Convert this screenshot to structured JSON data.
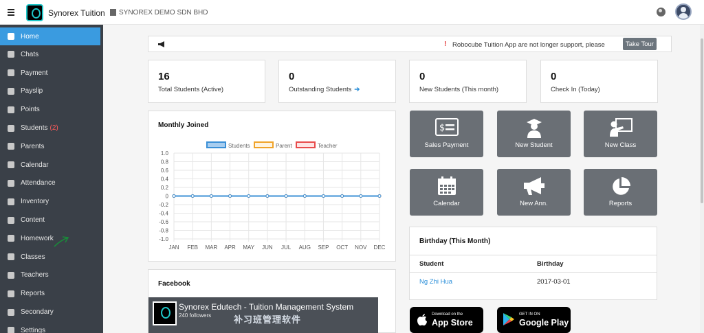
{
  "header": {
    "app_name": "Synorex Tuition",
    "org_name": "SYNOREX DEMO SDN BHD"
  },
  "sidebar": {
    "items": [
      {
        "label": "Home",
        "icon": "home-icon",
        "active": true
      },
      {
        "label": "Chats",
        "icon": "chat-icon"
      },
      {
        "label": "Payment",
        "icon": "document-icon"
      },
      {
        "label": "Payslip",
        "icon": "document-icon"
      },
      {
        "label": "Points",
        "icon": "star-icon"
      },
      {
        "label": "Students",
        "icon": "users-icon",
        "badge": "(2)"
      },
      {
        "label": "Parents",
        "icon": "user-circle-icon"
      },
      {
        "label": "Calendar",
        "icon": "calendar-icon"
      },
      {
        "label": "Attendance",
        "icon": "clock-icon"
      },
      {
        "label": "Inventory",
        "icon": "boxes-icon"
      },
      {
        "label": "Content",
        "icon": "megaphone-icon"
      },
      {
        "label": "Homework",
        "icon": "book-icon"
      },
      {
        "label": "Classes",
        "icon": "school-icon"
      },
      {
        "label": "Teachers",
        "icon": "teacher-icon"
      },
      {
        "label": "Reports",
        "icon": "pie-icon"
      },
      {
        "label": "Secondary",
        "icon": "cloud-icon"
      },
      {
        "label": "Settings",
        "icon": "gear-icon"
      }
    ]
  },
  "announcement": {
    "text": "Robocube Tuition App are not longer support, please",
    "tour_label": "Take Tour"
  },
  "stats": [
    {
      "value": "16",
      "label": "Total Students (Active)"
    },
    {
      "value": "0",
      "label": "Outstanding Students",
      "arrow": "➔"
    },
    {
      "value": "0",
      "label": "New Students (This month)"
    },
    {
      "value": "0",
      "label": "Check In (Today)"
    }
  ],
  "monthly_joined": {
    "title": "Monthly Joined"
  },
  "chart_data": {
    "type": "line",
    "categories": [
      "JAN",
      "FEB",
      "MAR",
      "APR",
      "MAY",
      "JUN",
      "JUL",
      "AUG",
      "SEP",
      "OCT",
      "NOV",
      "DEC"
    ],
    "series": [
      {
        "name": "Students",
        "values": [
          0,
          0,
          0,
          0,
          0,
          0,
          0,
          0,
          0,
          0,
          0,
          0
        ],
        "color": "#3a8fd6",
        "fill": "#a7cdef"
      },
      {
        "name": "Parent",
        "values": [
          0,
          0,
          0,
          0,
          0,
          0,
          0,
          0,
          0,
          0,
          0,
          0
        ],
        "color": "#f0a329",
        "fill": "#fff4e0"
      },
      {
        "name": "Teacher",
        "values": [
          0,
          0,
          0,
          0,
          0,
          0,
          0,
          0,
          0,
          0,
          0,
          0
        ],
        "color": "#e84b4b",
        "fill": "#fde3e3"
      }
    ],
    "yticks": [
      "1.0",
      "0.8",
      "0.6",
      "0.4",
      "0.2",
      "0",
      "-0.2",
      "-0.4",
      "-0.6",
      "-0.8",
      "-1.0"
    ],
    "ylim": [
      -1.0,
      1.0
    ],
    "grid": true,
    "legend": "top"
  },
  "facebook": {
    "title": "Facebook",
    "video_title": "Synorex Edutech - Tuition Management System",
    "followers": "240 followers",
    "banner_text": "补习班管理软件"
  },
  "quick_actions": [
    {
      "label": "Sales Payment",
      "icon": "invoice-icon"
    },
    {
      "label": "New Student",
      "icon": "graduate-icon"
    },
    {
      "label": "New Class",
      "icon": "classroom-icon"
    },
    {
      "label": "Calendar",
      "icon": "calendar-icon"
    },
    {
      "label": "New Ann.",
      "icon": "megaphone-icon"
    },
    {
      "label": "Reports",
      "icon": "pie-icon"
    }
  ],
  "birthday": {
    "title": "Birthday (This Month)",
    "columns": [
      "Student",
      "Birthday"
    ],
    "rows": [
      {
        "student": "Ng Zhi Hua",
        "birthday": "2017-03-01"
      }
    ]
  },
  "stores": {
    "apple_small": "Download on the",
    "apple_big": "App Store",
    "google_small": "GET IN ON",
    "google_big": "Google Play"
  }
}
